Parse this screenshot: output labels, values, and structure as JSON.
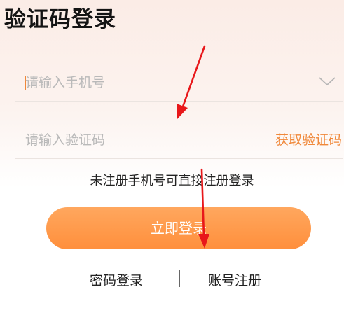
{
  "header": {
    "title": "验证码登录"
  },
  "phone": {
    "placeholder": "请输入手机号",
    "value": ""
  },
  "code": {
    "placeholder": "请输入验证码",
    "value": "",
    "get_code_label": "获取验证码"
  },
  "hint": "未注册手机号可直接注册登录",
  "login_button": "立即登录",
  "links": {
    "password_login": "密码登录",
    "register": "账号注册"
  },
  "colors": {
    "accent": "#f0883a",
    "button": "#ff9a4a",
    "annotation_arrow": "#e8171a"
  },
  "icons": {
    "phone_dropdown": "chevron-down-icon"
  }
}
